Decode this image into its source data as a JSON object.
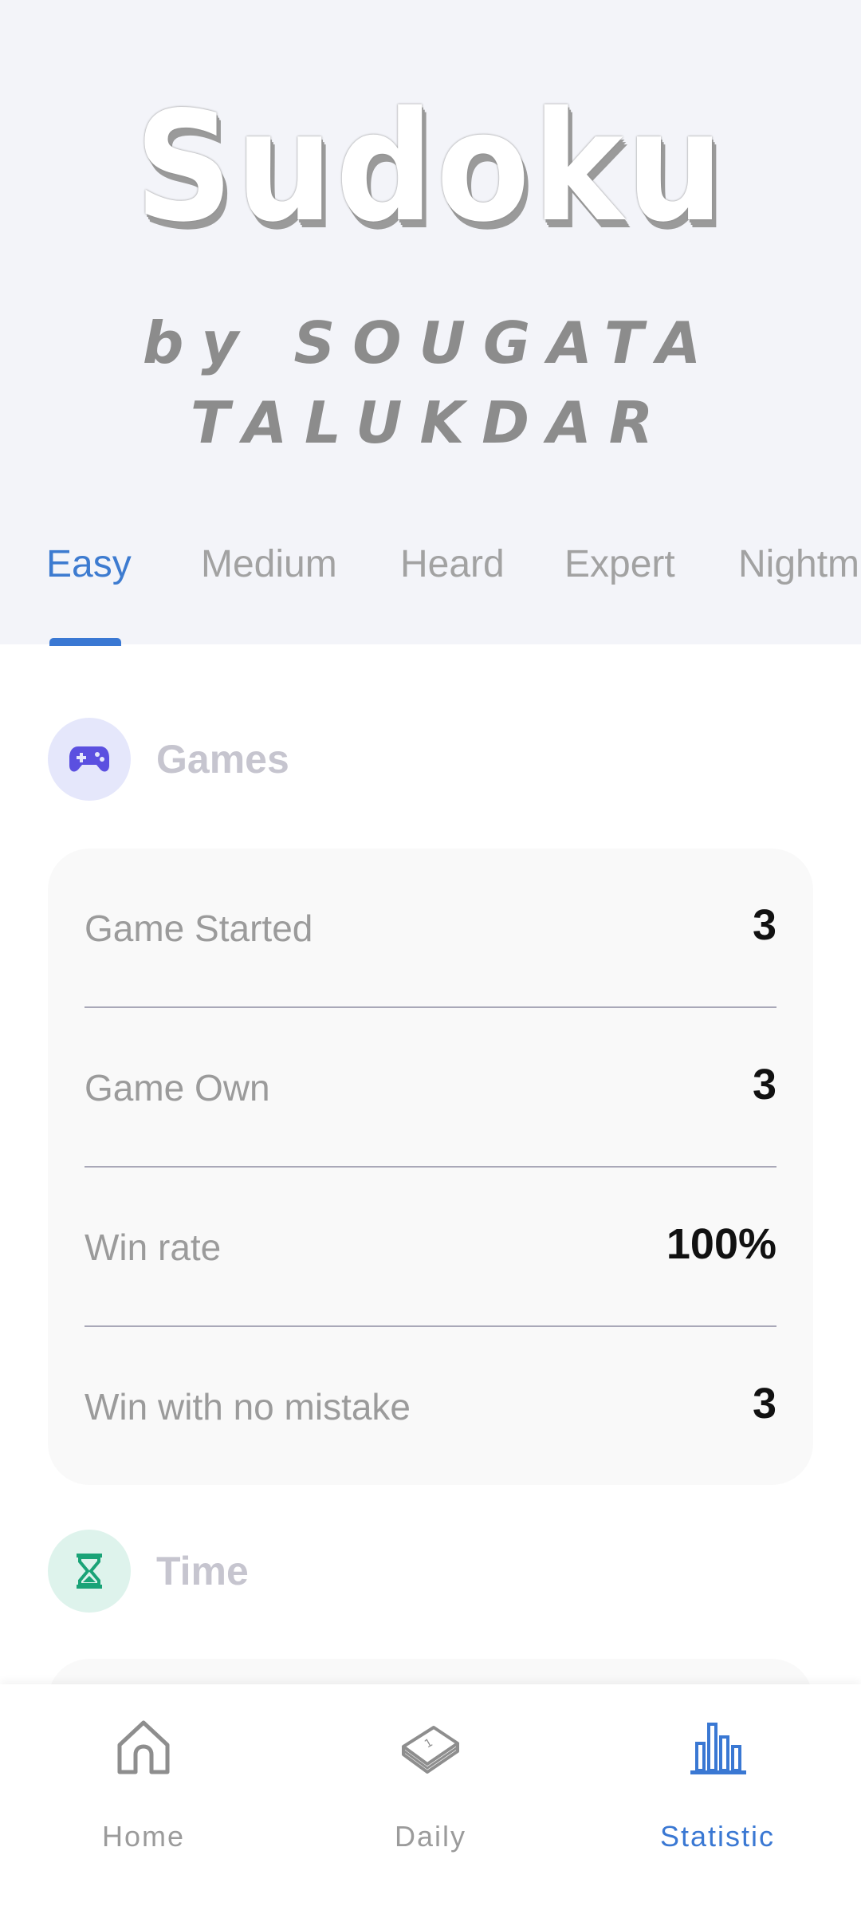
{
  "header": {
    "title": "Sudoku",
    "subtitle": "by SOUGATA TALUKDAR"
  },
  "tabs": [
    {
      "label": "Easy",
      "active": true
    },
    {
      "label": "Medium",
      "active": false
    },
    {
      "label": "Heard",
      "active": false
    },
    {
      "label": "Expert",
      "active": false
    },
    {
      "label": "Nightm",
      "active": false
    }
  ],
  "games": {
    "title": "Games",
    "icon": "gamepad-icon",
    "rows": [
      {
        "label": "Game Started",
        "value": "3"
      },
      {
        "label": "Game Own",
        "value": "3"
      },
      {
        "label": "Win rate",
        "value": "100%"
      },
      {
        "label": "Win with no mistake",
        "value": "3"
      }
    ]
  },
  "time": {
    "title": "Time",
    "icon": "hourglass-icon"
  },
  "bottom_nav": {
    "items": [
      {
        "label": "Home",
        "icon": "home-icon",
        "active": false
      },
      {
        "label": "Daily",
        "icon": "calendar-icon",
        "active": false
      },
      {
        "label": "Statistic",
        "icon": "bar-chart-icon",
        "active": true
      }
    ]
  },
  "colors": {
    "accent": "#3a78d3",
    "header_bg": "#f3f4f9",
    "games_icon_bg": "#e5e7fb",
    "games_icon": "#5b50e0",
    "time_icon_bg": "#def3ec",
    "time_icon": "#1aa377"
  }
}
